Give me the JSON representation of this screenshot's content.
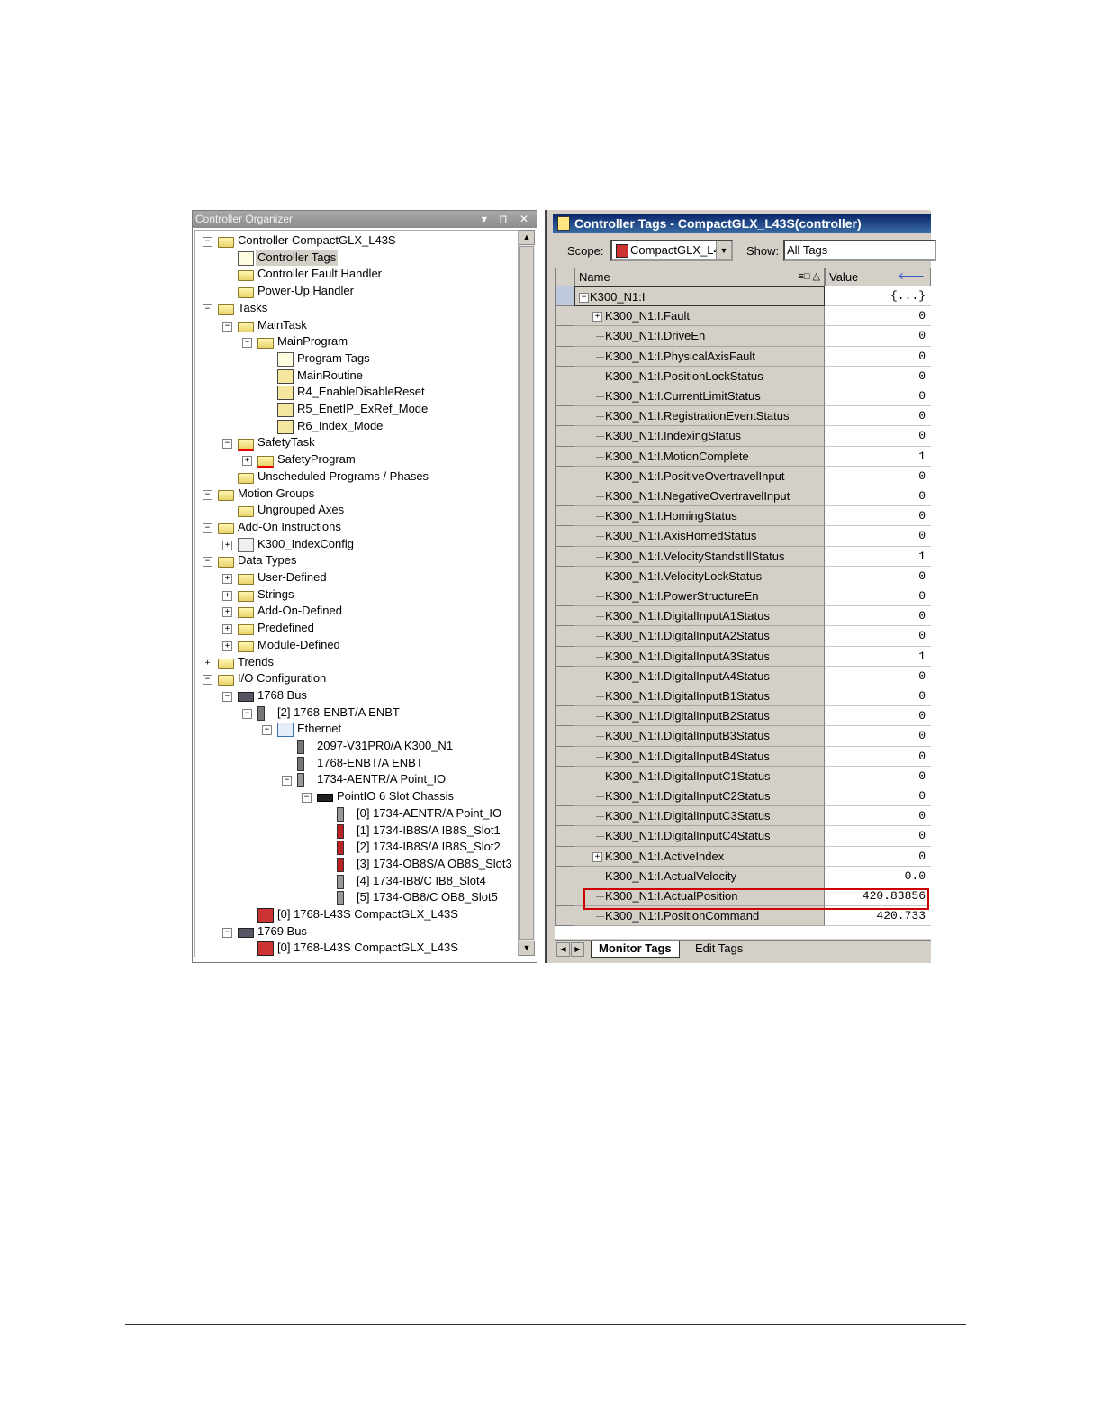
{
  "organizer": {
    "title": "Controller Organizer",
    "title_buttons": "▾ ⊓ ✕",
    "tree": [
      {
        "label": "Controller CompactGLX_L43S",
        "level": 0,
        "exp": "−",
        "icon": "folder-icon"
      },
      {
        "label": "Controller Tags",
        "level": 1,
        "exp": "",
        "icon": "tag-icon",
        "selected": true
      },
      {
        "label": "Controller Fault Handler",
        "level": 1,
        "exp": "",
        "icon": "folder-icon"
      },
      {
        "label": "Power-Up Handler",
        "level": 1,
        "exp": "",
        "icon": "folder-icon"
      },
      {
        "label": "Tasks",
        "level": 0,
        "exp": "−",
        "icon": "folder-icon"
      },
      {
        "label": "MainTask",
        "level": 1,
        "exp": "−",
        "icon": "task-icon"
      },
      {
        "label": "MainProgram",
        "level": 2,
        "exp": "−",
        "icon": "program-icon"
      },
      {
        "label": "Program Tags",
        "level": 3,
        "exp": "",
        "icon": "tag-icon"
      },
      {
        "label": "MainRoutine",
        "level": 3,
        "exp": "",
        "icon": "routine-icon"
      },
      {
        "label": "R4_EnableDisableReset",
        "level": 3,
        "exp": "",
        "icon": "routine-icon"
      },
      {
        "label": "R5_EnetIP_ExRef_Mode",
        "level": 3,
        "exp": "",
        "icon": "routine-icon"
      },
      {
        "label": "R6_Index_Mode",
        "level": 3,
        "exp": "",
        "icon": "routine-icon"
      },
      {
        "label": "SafetyTask",
        "level": 1,
        "exp": "−",
        "icon": "safety-task-icon"
      },
      {
        "label": "SafetyProgram",
        "level": 2,
        "exp": "+",
        "icon": "safety-program-icon"
      },
      {
        "label": "Unscheduled Programs / Phases",
        "level": 1,
        "exp": "",
        "icon": "folder-icon"
      },
      {
        "label": "Motion Groups",
        "level": 0,
        "exp": "−",
        "icon": "folder-icon"
      },
      {
        "label": "Ungrouped Axes",
        "level": 1,
        "exp": "",
        "icon": "folder-icon"
      },
      {
        "label": "Add-On Instructions",
        "level": 0,
        "exp": "−",
        "icon": "folder-icon"
      },
      {
        "label": "K300_IndexConfig",
        "level": 1,
        "exp": "+",
        "icon": "aoi-icon"
      },
      {
        "label": "Data Types",
        "level": 0,
        "exp": "−",
        "icon": "folder-icon"
      },
      {
        "label": "User-Defined",
        "level": 1,
        "exp": "+",
        "icon": "datatype-icon"
      },
      {
        "label": "Strings",
        "level": 1,
        "exp": "+",
        "icon": "datatype-icon"
      },
      {
        "label": "Add-On-Defined",
        "level": 1,
        "exp": "+",
        "icon": "datatype-icon"
      },
      {
        "label": "Predefined",
        "level": 1,
        "exp": "+",
        "icon": "datatype-icon"
      },
      {
        "label": "Module-Defined",
        "level": 1,
        "exp": "+",
        "icon": "datatype-icon"
      },
      {
        "label": "Trends",
        "level": 0,
        "exp": "+",
        "icon": "folder-icon"
      },
      {
        "label": "I/O Configuration",
        "level": 0,
        "exp": "−",
        "icon": "folder-icon"
      },
      {
        "label": "1768 Bus",
        "level": 1,
        "exp": "−",
        "icon": "bus-icon"
      },
      {
        "label": "[2] 1768-ENBT/A ENBT",
        "level": 2,
        "exp": "−",
        "icon": "module-icon"
      },
      {
        "label": "Ethernet",
        "level": 3,
        "exp": "−",
        "icon": "network-icon"
      },
      {
        "label": "2097-V31PR0/A K300_N1",
        "level": 4,
        "exp": "",
        "icon": "module-icon"
      },
      {
        "label": "1768-ENBT/A ENBT",
        "level": 4,
        "exp": "",
        "icon": "module-icon"
      },
      {
        "label": "1734-AENTR/A Point_IO",
        "level": 4,
        "exp": "−",
        "icon": "grey-module-icon"
      },
      {
        "label": "PointIO 6 Slot Chassis",
        "level": 5,
        "exp": "−",
        "icon": "chassis-icon"
      },
      {
        "label": "[0] 1734-AENTR/A Point_IO",
        "level": 6,
        "exp": "",
        "icon": "grey-module-icon"
      },
      {
        "label": "[1] 1734-IB8S/A IB8S_Slot1",
        "level": 6,
        "exp": "",
        "icon": "red-module-icon"
      },
      {
        "label": "[2] 1734-IB8S/A IB8S_Slot2",
        "level": 6,
        "exp": "",
        "icon": "red-module-icon"
      },
      {
        "label": "[3] 1734-OB8S/A OB8S_Slot3",
        "level": 6,
        "exp": "",
        "icon": "red-module-icon"
      },
      {
        "label": "[4] 1734-IB8/C IB8_Slot4",
        "level": 6,
        "exp": "",
        "icon": "grey-module-icon"
      },
      {
        "label": "[5] 1734-OB8/C OB8_Slot5",
        "level": 6,
        "exp": "",
        "icon": "grey-module-icon"
      },
      {
        "label": "[0] 1768-L43S CompactGLX_L43S",
        "level": 2,
        "exp": "",
        "icon": "controller-icon"
      },
      {
        "label": "1769 Bus",
        "level": 1,
        "exp": "−",
        "icon": "bus-icon"
      },
      {
        "label": "[0] 1768-L43S CompactGLX_L43S",
        "level": 2,
        "exp": "",
        "icon": "controller-icon"
      }
    ]
  },
  "tags": {
    "title": "Controller Tags - CompactGLX_L43S(controller)",
    "scope_label": "Scope:",
    "scope_value": "CompactGLX_L4",
    "show_label": "Show:",
    "show_value": "All Tags",
    "col_name": "Name",
    "col_name_buttons": "≡□ △",
    "col_value": "Value",
    "col_value_arrow": "🡐",
    "rows": [
      {
        "name": "K300_N1:I",
        "value": "{...}",
        "exp": "−",
        "indent": 0
      },
      {
        "name": "K300_N1:I.Fault",
        "value": "0",
        "exp": "+",
        "indent": 1
      },
      {
        "name": "K300_N1:I.DriveEn",
        "value": "0",
        "exp": "",
        "indent": 1
      },
      {
        "name": "K300_N1:I.PhysicalAxisFault",
        "value": "0",
        "exp": "",
        "indent": 1
      },
      {
        "name": "K300_N1:I.PositionLockStatus",
        "value": "0",
        "exp": "",
        "indent": 1
      },
      {
        "name": "K300_N1:I.CurrentLimitStatus",
        "value": "0",
        "exp": "",
        "indent": 1
      },
      {
        "name": "K300_N1:I.RegistrationEventStatus",
        "value": "0",
        "exp": "",
        "indent": 1
      },
      {
        "name": "K300_N1:I.IndexingStatus",
        "value": "0",
        "exp": "",
        "indent": 1
      },
      {
        "name": "K300_N1:I.MotionComplete",
        "value": "1",
        "exp": "",
        "indent": 1
      },
      {
        "name": "K300_N1:I.PositiveOvertravelInput",
        "value": "0",
        "exp": "",
        "indent": 1
      },
      {
        "name": "K300_N1:I.NegativeOvertravelInput",
        "value": "0",
        "exp": "",
        "indent": 1
      },
      {
        "name": "K300_N1:I.HomingStatus",
        "value": "0",
        "exp": "",
        "indent": 1
      },
      {
        "name": "K300_N1:I.AxisHomedStatus",
        "value": "0",
        "exp": "",
        "indent": 1
      },
      {
        "name": "K300_N1:I.VelocityStandstillStatus",
        "value": "1",
        "exp": "",
        "indent": 1
      },
      {
        "name": "K300_N1:I.VelocityLockStatus",
        "value": "0",
        "exp": "",
        "indent": 1
      },
      {
        "name": "K300_N1:I.PowerStructureEn",
        "value": "0",
        "exp": "",
        "indent": 1
      },
      {
        "name": "K300_N1:I.DigitalInputA1Status",
        "value": "0",
        "exp": "",
        "indent": 1
      },
      {
        "name": "K300_N1:I.DigitalInputA2Status",
        "value": "0",
        "exp": "",
        "indent": 1
      },
      {
        "name": "K300_N1:I.DigitalInputA3Status",
        "value": "1",
        "exp": "",
        "indent": 1
      },
      {
        "name": "K300_N1:I.DigitalInputA4Status",
        "value": "0",
        "exp": "",
        "indent": 1
      },
      {
        "name": "K300_N1:I.DigitalInputB1Status",
        "value": "0",
        "exp": "",
        "indent": 1
      },
      {
        "name": "K300_N1:I.DigitalInputB2Status",
        "value": "0",
        "exp": "",
        "indent": 1
      },
      {
        "name": "K300_N1:I.DigitalInputB3Status",
        "value": "0",
        "exp": "",
        "indent": 1
      },
      {
        "name": "K300_N1:I.DigitalInputB4Status",
        "value": "0",
        "exp": "",
        "indent": 1
      },
      {
        "name": "K300_N1:I.DigitalInputC1Status",
        "value": "0",
        "exp": "",
        "indent": 1
      },
      {
        "name": "K300_N1:I.DigitalInputC2Status",
        "value": "0",
        "exp": "",
        "indent": 1
      },
      {
        "name": "K300_N1:I.DigitalInputC3Status",
        "value": "0",
        "exp": "",
        "indent": 1
      },
      {
        "name": "K300_N1:I.DigitalInputC4Status",
        "value": "0",
        "exp": "",
        "indent": 1
      },
      {
        "name": "K300_N1:I.ActiveIndex",
        "value": "0",
        "exp": "+",
        "indent": 1
      },
      {
        "name": "K300_N1:I.ActualVelocity",
        "value": "0.0",
        "exp": "",
        "indent": 1
      },
      {
        "name": "K300_N1:I.ActualPosition",
        "value": "420.83856",
        "exp": "",
        "indent": 1,
        "highlighted": true
      },
      {
        "name": "K300_N1:I.PositionCommand",
        "value": "420.733",
        "exp": "",
        "indent": 1
      }
    ],
    "tabs": [
      {
        "label": "Monitor Tags",
        "active": true
      },
      {
        "label": "Edit Tags",
        "active": false
      }
    ],
    "highlight_color": "#cc0000"
  }
}
